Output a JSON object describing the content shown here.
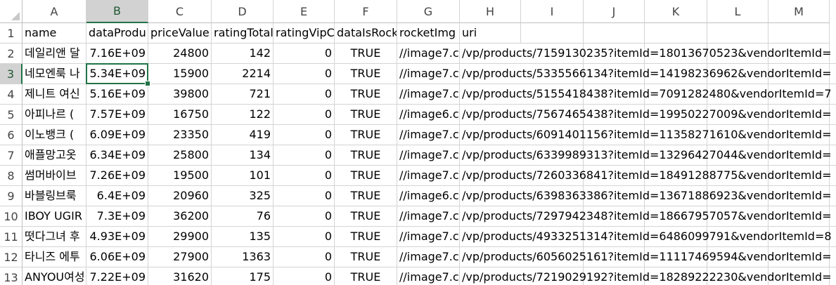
{
  "columns": [
    "A",
    "B",
    "C",
    "D",
    "E",
    "F",
    "G",
    "H",
    "I",
    "J",
    "K",
    "L",
    "M"
  ],
  "row_numbers": [
    "1",
    "2",
    "3",
    "4",
    "5",
    "6",
    "7",
    "8",
    "9",
    "10",
    "11",
    "12",
    "13"
  ],
  "selected_column": "B",
  "selected_row": "3",
  "accent_color": "#217346",
  "rows": [
    [
      "name",
      "dataProdu",
      "priceValue",
      "ratingTotal",
      "ratingVipC",
      "dataIsRock",
      "rocketImg",
      "uri"
    ],
    [
      "데일리앤 달",
      "7.16E+09",
      "24800",
      "142",
      "0",
      "TRUE",
      "//image7.c",
      "/vp/products/7159130235?itemId=18013670523&vendorItemId="
    ],
    [
      "네모엔룩 나",
      "5.34E+09",
      "15900",
      "2214",
      "0",
      "TRUE",
      "//image7.c",
      "/vp/products/5335566134?itemId=14198236962&vendorItemId="
    ],
    [
      "제니트 여신",
      "5.16E+09",
      "39800",
      "721",
      "0",
      "TRUE",
      "//image7.c",
      "/vp/products/5155418438?itemId=7091282480&vendorItemId=7"
    ],
    [
      "아피나르 (",
      "7.57E+09",
      "16750",
      "122",
      "0",
      "TRUE",
      "//image6.c",
      "/vp/products/7567465438?itemId=19950227009&vendorItemId="
    ],
    [
      "이노뱅크 (",
      "6.09E+09",
      "23350",
      "419",
      "0",
      "TRUE",
      "//image7.c",
      "/vp/products/6091401156?itemId=11358271610&vendorItemId="
    ],
    [
      "애플망고옷",
      "6.34E+09",
      "25800",
      "134",
      "0",
      "TRUE",
      "//image7.c",
      "/vp/products/6339989313?itemId=13296427044&vendorItemId="
    ],
    [
      "썸머바이브",
      "7.26E+09",
      "19500",
      "101",
      "0",
      "TRUE",
      "//image7.c",
      "/vp/products/7260336841?itemId=18491288775&vendorItemId="
    ],
    [
      "바블링브룩",
      "6.4E+09",
      "20960",
      "325",
      "0",
      "TRUE",
      "//image6.c",
      "/vp/products/6398363386?itemId=13671886923&vendorItemId="
    ],
    [
      "IBOY UGIR",
      "7.3E+09",
      "36200",
      "76",
      "0",
      "TRUE",
      "//image7.c",
      "/vp/products/7297942348?itemId=18667957057&vendorItemId="
    ],
    [
      "떳다그녀 후",
      "4.93E+09",
      "29900",
      "135",
      "0",
      "TRUE",
      "//image7.c",
      "/vp/products/4933251314?itemId=6486099791&vendorItemId=8"
    ],
    [
      "타니즈 에투",
      "6.06E+09",
      "27900",
      "1363",
      "0",
      "TRUE",
      "//image7.c",
      "/vp/products/6056025161?itemId=11117469594&vendorItemId="
    ],
    [
      "ANYOU여성",
      "7.22E+09",
      "31620",
      "175",
      "0",
      "TRUE",
      "//image7.c",
      "/vp/products/7219029192?itemId=18289222230&vendorItemId="
    ]
  ]
}
